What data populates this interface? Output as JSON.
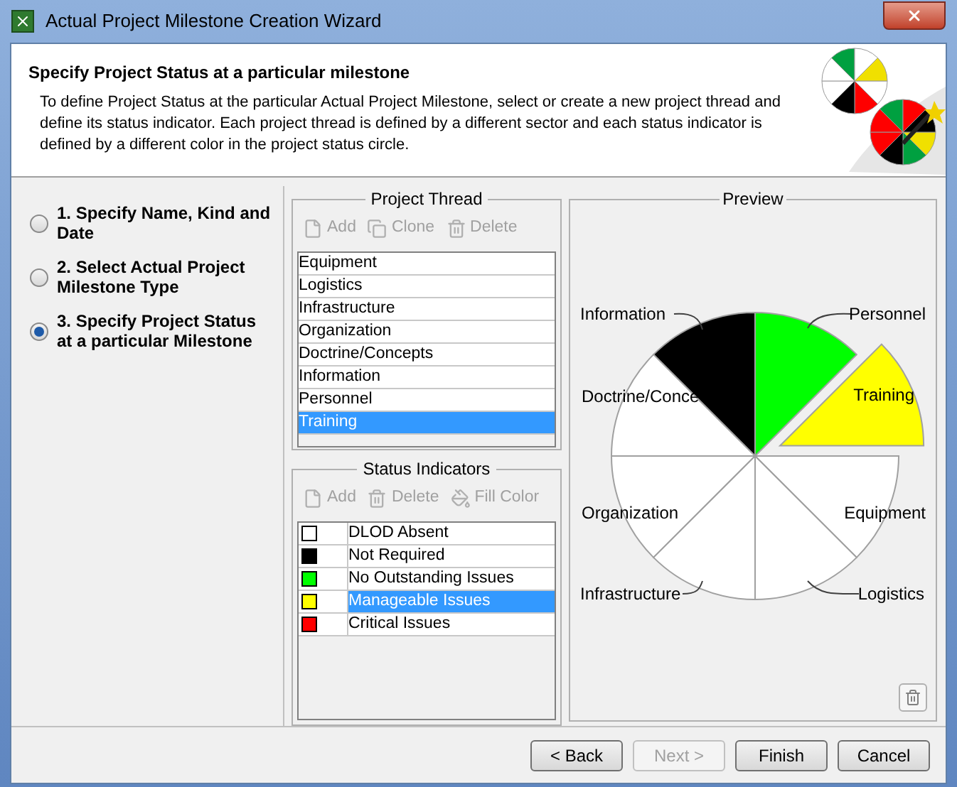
{
  "window": {
    "title": "Actual Project Milestone Creation Wizard"
  },
  "header": {
    "title": "Specify Project Status at a particular milestone",
    "description": "To define Project Status at the particular Actual Project Milestone, select or create a new project thread and define its status indicator. Each project thread is defined by a different sector and each status indicator is defined by a different color in the project status circle."
  },
  "steps": [
    {
      "label": "1. Specify Name, Kind and Date",
      "selected": false
    },
    {
      "label": "2. Select Actual Project Milestone Type",
      "selected": false
    },
    {
      "label": "3. Specify Project Status at a particular Milestone",
      "selected": true
    }
  ],
  "project_thread": {
    "title": "Project Thread",
    "toolbar": [
      {
        "kind": "add",
        "label": "Add",
        "disabled": true
      },
      {
        "kind": "clone",
        "label": "Clone",
        "disabled": true
      },
      {
        "kind": "delete",
        "label": "Delete",
        "disabled": true
      }
    ],
    "items": [
      {
        "label": "Equipment",
        "selected": false
      },
      {
        "label": "Logistics",
        "selected": false
      },
      {
        "label": "Infrastructure",
        "selected": false
      },
      {
        "label": "Organization",
        "selected": false
      },
      {
        "label": "Doctrine/Concepts",
        "selected": false
      },
      {
        "label": "Information",
        "selected": false
      },
      {
        "label": "Personnel",
        "selected": false
      },
      {
        "label": "Training",
        "selected": true
      }
    ]
  },
  "status_indicators": {
    "title": "Status Indicators",
    "toolbar": [
      {
        "kind": "add",
        "label": "Add",
        "disabled": true
      },
      {
        "kind": "delete",
        "label": "Delete",
        "disabled": true
      },
      {
        "kind": "fill",
        "label": "Fill Color",
        "disabled": true
      }
    ],
    "items": [
      {
        "label": "DLOD Absent",
        "color": "#ffffff",
        "selected": false
      },
      {
        "label": "Not Required",
        "color": "#000000",
        "selected": false
      },
      {
        "label": "No Outstanding Issues",
        "color": "#00ff00",
        "selected": false
      },
      {
        "label": "Manageable Issues",
        "color": "#ffff00",
        "selected": true
      },
      {
        "label": "Critical Issues",
        "color": "#ff0000",
        "selected": false
      }
    ]
  },
  "preview": {
    "title": "Preview",
    "sectors": [
      {
        "label": "Information",
        "color": "#000000",
        "selected": false
      },
      {
        "label": "Personnel",
        "color": "#00ff00",
        "selected": false
      },
      {
        "label": "Doctrine/Conce",
        "color": "#ffffff",
        "selected": false
      },
      {
        "label": "Training",
        "color": "#ffff00",
        "selected": true
      },
      {
        "label": "Organization",
        "color": "#ffffff",
        "selected": false
      },
      {
        "label": "Equipment",
        "color": "#ffffff",
        "selected": false
      },
      {
        "label": "Infrastructure",
        "color": "#ffffff",
        "selected": false
      },
      {
        "label": "Logistics",
        "color": "#ffffff",
        "selected": false
      }
    ]
  },
  "buttons": [
    {
      "label": "< Back",
      "disabled": false
    },
    {
      "label": "Next >",
      "disabled": true
    },
    {
      "label": "Finish",
      "disabled": false
    },
    {
      "label": "Cancel",
      "disabled": false
    }
  ]
}
